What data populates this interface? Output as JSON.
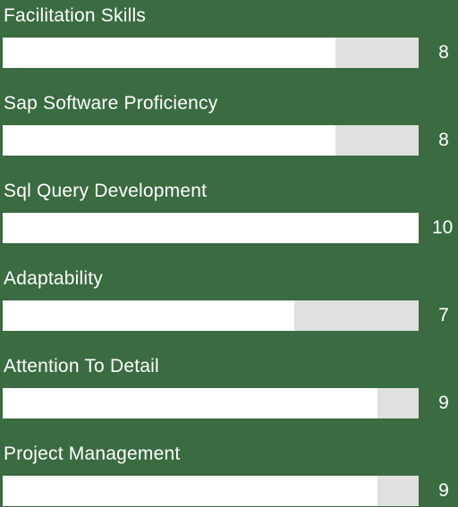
{
  "colors": {
    "background": "#3a6b41",
    "bar_fill": "#ffffff",
    "bar_track": "#e0e0e0",
    "text": "#ffffff"
  },
  "scale_max": 10,
  "skills": [
    {
      "label": "Facilitation Skills",
      "value": "8",
      "level": 8
    },
    {
      "label": "Sap Software Proficiency",
      "value": "8",
      "level": 8
    },
    {
      "label": "Sql Query Development",
      "value": "10",
      "level": 10
    },
    {
      "label": "Adaptability",
      "value": "7",
      "level": 7
    },
    {
      "label": "Attention To Detail",
      "value": "9",
      "level": 9
    },
    {
      "label": "Project Management",
      "value": "9",
      "level": 9
    }
  ]
}
